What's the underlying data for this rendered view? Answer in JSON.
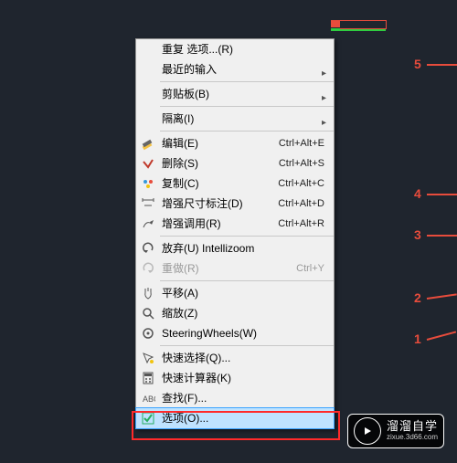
{
  "annotations": {
    "n1": "1",
    "n2": "2",
    "n3": "3",
    "n4": "4",
    "n5": "5"
  },
  "menu": {
    "repeat": "重复 选项...(R)",
    "recent": "最近的输入",
    "clipboard": "剪贴板(B)",
    "isolate": "隔离(I)",
    "edit": {
      "label": "编辑(E)",
      "key": "Ctrl+Alt+E"
    },
    "delete": {
      "label": "删除(S)",
      "key": "Ctrl+Alt+S"
    },
    "copy": {
      "label": "复制(C)",
      "key": "Ctrl+Alt+C"
    },
    "enh_dim": {
      "label": "增强尺寸标注(D)",
      "key": "Ctrl+Alt+D"
    },
    "enh_adj": {
      "label": "增强调用(R)",
      "key": "Ctrl+Alt+R"
    },
    "undo": {
      "label": "放弃(U) Intellizoom",
      "key": ""
    },
    "redo": {
      "label": "重做(R)",
      "key": "Ctrl+Y"
    },
    "pan": "平移(A)",
    "zoom": "缩放(Z)",
    "swheels": "SteeringWheels(W)",
    "qselect": "快速选择(Q)...",
    "qcalc": "快速计算器(K)",
    "find": "查找(F)...",
    "options": "选项(O)..."
  },
  "badge": {
    "title": "溜溜自学",
    "sub": "zixue.3d66.com"
  }
}
